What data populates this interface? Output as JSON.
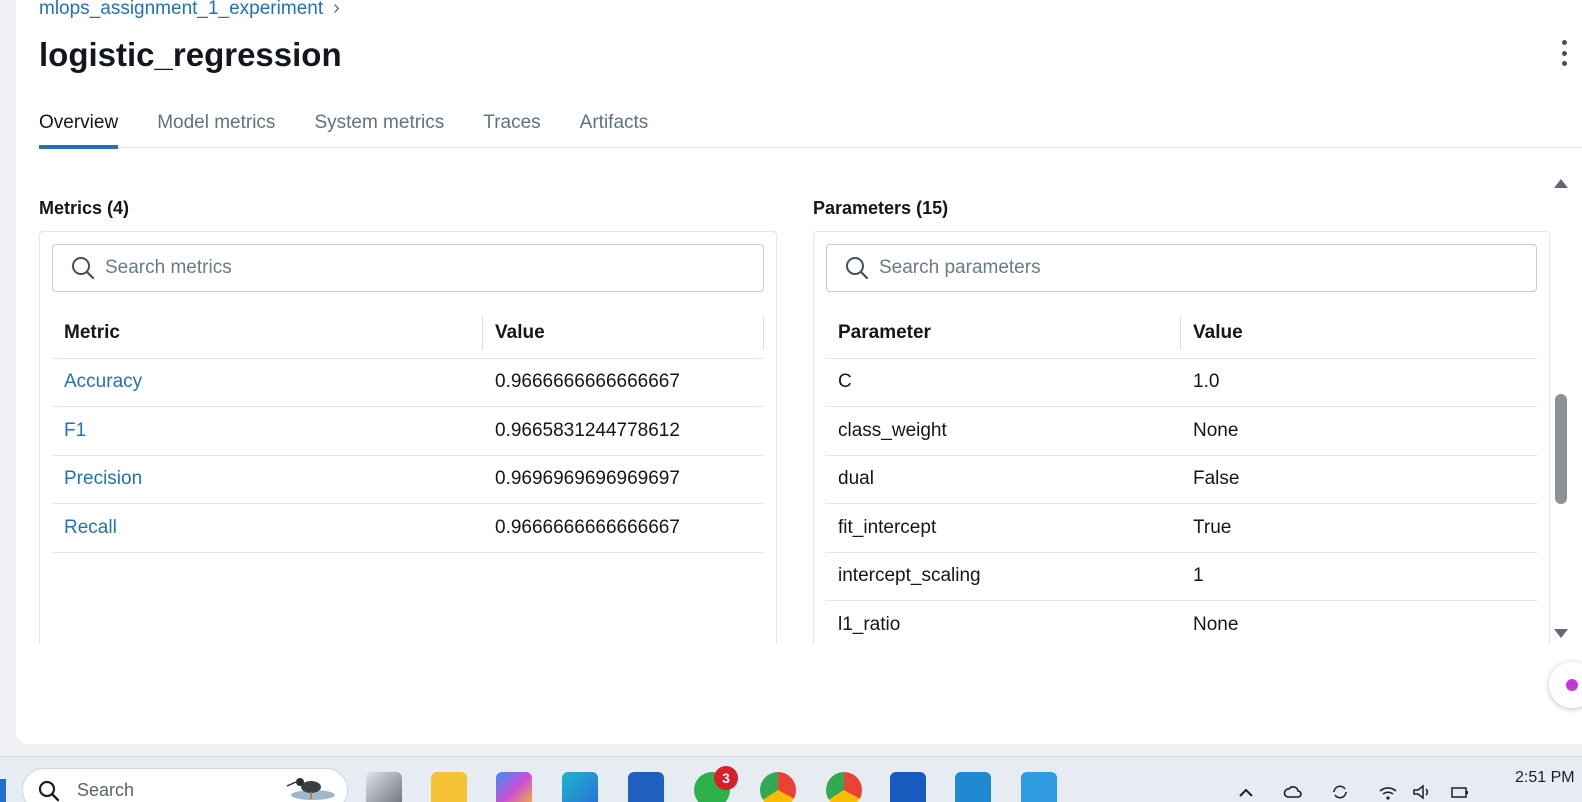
{
  "breadcrumb": {
    "experiment": "mlops_assignment_1_experiment",
    "separator": "›"
  },
  "run_title": "logistic_regression",
  "tabs": [
    {
      "label": "Overview",
      "active": true
    },
    {
      "label": "Model metrics",
      "active": false
    },
    {
      "label": "System metrics",
      "active": false
    },
    {
      "label": "Traces",
      "active": false
    },
    {
      "label": "Artifacts",
      "active": false
    }
  ],
  "metrics": {
    "title": "Metrics (4)",
    "search_placeholder": "Search metrics",
    "columns": [
      "Metric",
      "Value"
    ],
    "rows": [
      {
        "name": "Accuracy",
        "value": "0.9666666666666667"
      },
      {
        "name": "F1",
        "value": "0.9665831244778612"
      },
      {
        "name": "Precision",
        "value": "0.9696969696969697"
      },
      {
        "name": "Recall",
        "value": "0.9666666666666667"
      }
    ]
  },
  "parameters": {
    "title": "Parameters (15)",
    "search_placeholder": "Search parameters",
    "columns": [
      "Parameter",
      "Value"
    ],
    "rows": [
      {
        "name": "C",
        "value": "1.0"
      },
      {
        "name": "class_weight",
        "value": "None"
      },
      {
        "name": "dual",
        "value": "False"
      },
      {
        "name": "fit_intercept",
        "value": "True"
      },
      {
        "name": "intercept_scaling",
        "value": "1"
      },
      {
        "name": "l1_ratio",
        "value": "None"
      }
    ]
  },
  "taskbar": {
    "search_label": "Search",
    "notification_badge": "3",
    "clock": "2:51 PM"
  },
  "colors": {
    "accent": "#2272b4",
    "link": "#2272b4",
    "badge": "#d6202c"
  }
}
